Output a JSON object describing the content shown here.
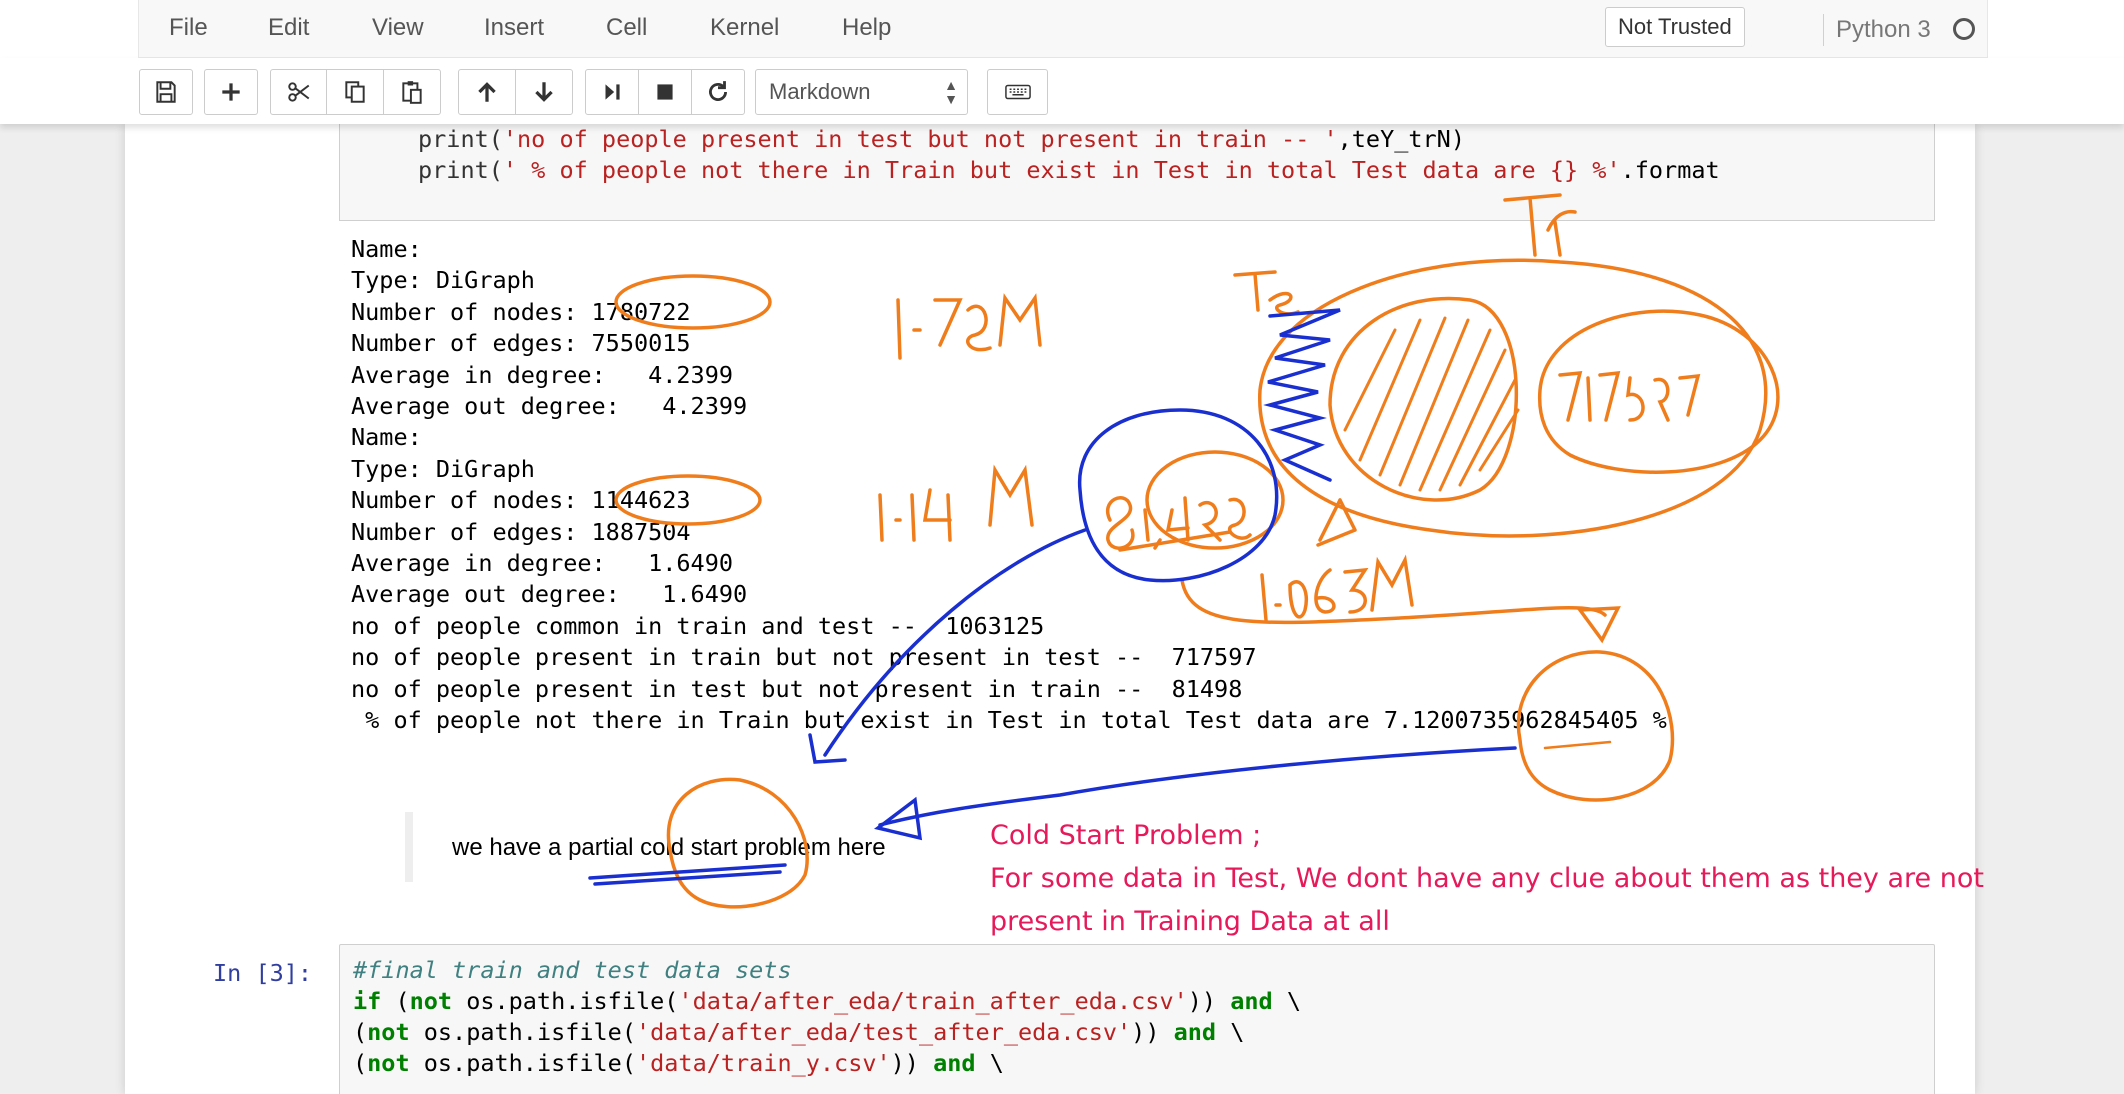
{
  "menu": {
    "items": [
      "File",
      "Edit",
      "View",
      "Insert",
      "Cell",
      "Kernel",
      "Help"
    ],
    "not_trusted": "Not Trusted",
    "kernel_name": "Python 3"
  },
  "toolbar": {
    "cell_type": "Markdown",
    "buttons": [
      "save-icon",
      "plus-icon",
      "cut-icon",
      "copy-icon",
      "paste-icon",
      "arrow-up-icon",
      "arrow-down-icon",
      "run-icon",
      "stop-icon",
      "restart-icon",
      "keyboard-icon"
    ]
  },
  "prev_input": {
    "line1_fn": "print(",
    "line1_str": "'no of people present in test but not present in train -- '",
    "line1_rest": ",teY_trN)",
    "line2_fn": "print(",
    "line2_str": "' % of people not there in Train but exist in Test in total Test data are {} %'",
    "line2_rest": ".format"
  },
  "output_lines": [
    "Name:",
    "Type: DiGraph",
    "Number of nodes: 1780722",
    "Number of edges: 7550015",
    "Average in degree:   4.2399",
    "Average out degree:   4.2399",
    "Name:",
    "Type: DiGraph",
    "Number of nodes: 1144623",
    "Number of edges: 1887504",
    "Average in degree:   1.6490",
    "Average out degree:   1.6490",
    "no of people common in train and test --  1063125",
    "no of people present in train but not present in test --  717597",
    "no of people present in test but not present in train --  81498",
    " % of people not there in Train but exist in Test in total Test data are 7.1200735962845405 %"
  ],
  "markdown_text": "we have a partial cold start problem here",
  "code_cell": {
    "prompt": "In [3]:",
    "comment": "#final train and test data sets",
    "l2_kw1": "if",
    "l2_a": " (",
    "l2_kw2": "not",
    "l2_b": " os.path.isfile(",
    "l2_str": "'data/after_eda/train_after_eda.csv'",
    "l2_c": ")) ",
    "l2_kw3": "and",
    "l2_d": " \\",
    "l3_a": "(",
    "l3_kw1": "not",
    "l3_b": " os.path.isfile(",
    "l3_str": "'data/after_eda/test_after_eda.csv'",
    "l3_c": ")) ",
    "l3_kw2": "and",
    "l3_d": " \\",
    "l4_a": "(",
    "l4_kw1": "not",
    "l4_b": " os.path.isfile(",
    "l4_str": "'data/train_y.csv'",
    "l4_c": ")) ",
    "l4_kw2": "and",
    "l4_d": " \\"
  },
  "annotations": {
    "note_title": "Cold Start Problem ;",
    "note_line1": "For some data in Test, We dont have any clue about them as they are not",
    "note_line2": "present in Training Data at all",
    "hw_tr": "Tr",
    "hw_te": "Te",
    "hw_178": "1.78M",
    "hw_114": "1.14 M",
    "hw_106": "1.063M",
    "hw_81": "81,498",
    "hw_717": "717597",
    "colors": {
      "orange": "#f07d1c",
      "blue": "#1a2fd0",
      "pink": "#e6195a"
    }
  }
}
